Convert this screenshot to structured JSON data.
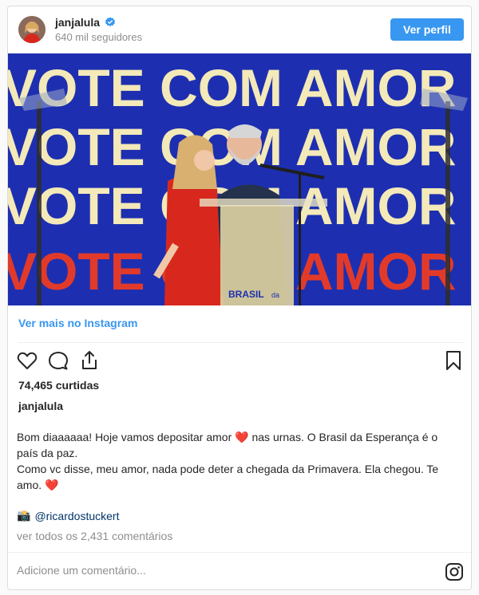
{
  "header": {
    "username": "janjalula",
    "followers": "640 mil seguidores",
    "view_profile_label": "Ver perfil"
  },
  "photo": {
    "banner_text": "VOTE COM AMOR",
    "podium_logo": "BRASIL",
    "podium_logo_suffix": "da"
  },
  "more_link": "Ver mais no Instagram",
  "actions": {
    "icons": [
      "heart-icon",
      "comment-icon",
      "share-icon",
      "bookmark-icon"
    ]
  },
  "likes": "74,465 curtidas",
  "owner": "janjalula",
  "caption": {
    "line1": "Bom diaaaaaa! Hoje vamos depositar amor ",
    "heart": "❤️",
    "line1b": " nas urnas. O Brasil da Esperança é o país da paz.",
    "line2": "Como vc disse, meu amor, nada pode deter a chegada da Primavera. Ela chegou. Te amo. "
  },
  "credit": {
    "camera": "📸",
    "handle": "@ricardostuckert"
  },
  "comments_link": "ver todos os 2,431 comentários",
  "comment_box": {
    "placeholder": "Adicione um comentário..."
  },
  "colors": {
    "accent": "#3897f0",
    "banner_bg": "#1d2fb0",
    "banner_text": "#f4e9b8",
    "banner_text_bottom": "#e23a2a"
  }
}
